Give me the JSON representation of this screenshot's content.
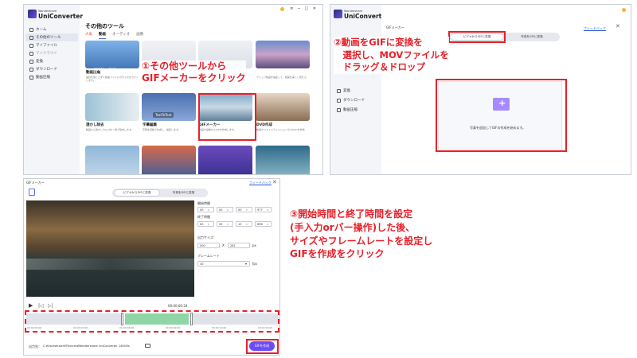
{
  "panel1": {
    "brand_small": "Wondershare",
    "brand_big": "UniConverter",
    "titlebar_icons": "≡ ─ □ ✕",
    "sidebar": [
      {
        "label": "ホーム",
        "active": false
      },
      {
        "label": "その他のツール",
        "active": true
      },
      {
        "label": "マイファイル",
        "active": false
      },
      {
        "label": "マイクラウド",
        "active": false
      },
      {
        "label": "変換",
        "active": false
      },
      {
        "label": "ダウンロード",
        "active": false
      },
      {
        "label": "動画圧縮",
        "active": false
      }
    ],
    "heading": "その他のツール",
    "tabs": [
      "人気",
      "動画",
      "オーディオ",
      "画像"
    ],
    "tiles": [
      {
        "title": "動画圧縮",
        "desc": "品質を落とさずに動画ファイルのサイズを小さくします。"
      },
      {
        "title": "",
        "desc": ""
      },
      {
        "title": "",
        "desc": ""
      },
      {
        "title": "",
        "desc": "クリップ動画を編集して、動画を美しく見せる"
      },
      {
        "title": "透かし除去",
        "desc": "動画から透かしやロゴを一括で除去します。"
      },
      {
        "title": "字幕編集",
        "desc": "字幕を自動で生成し、編集します。"
      },
      {
        "title": "GIFメーカー",
        "desc": "動画や画像からGIFを作成します。"
      },
      {
        "title": "DVD作成",
        "desc": "動画やフォトスライドショーからDVDを作成"
      }
    ],
    "tile_texts": {
      "resolution": "200M → 20M",
      "text_to_text": "TextToText"
    },
    "annotation": "①その他ツールから\nGIFメーカーをクリック"
  },
  "panel2": {
    "brand_small": "Wondershare",
    "brand_big": "UniConvert",
    "window_title": "GIFメーカー",
    "feedback": "フィードバック",
    "close": "✕",
    "toggle": [
      "ビデオからGIFに変換",
      "写真をGIFに変換"
    ],
    "annotation": "②動画をGIFに変換を\n　選択し、MOVファイルを\n　ドラッグ＆ドロップ",
    "sidebar": [
      "変換",
      "ダウンロード",
      "動画圧縮"
    ],
    "drop_text": "写真を追加してGIFの作成を始めます。",
    "add_symbol": "+"
  },
  "panel3": {
    "window_title": "GIFメーカー",
    "feedback": "フィードバック",
    "close": "✕",
    "toggle": [
      "ビデオからGIFに変換",
      "写真をGIFに変換"
    ],
    "start_label": "開始時間",
    "end_label": "終了時間",
    "start_time": [
      "00",
      "00",
      "00",
      "977"
    ],
    "end_time": [
      "00",
      "00",
      "15",
      "696"
    ],
    "size_label": "出力サイズ：",
    "width": "500",
    "height": "281",
    "unit": "px",
    "x_sign": "X",
    "fps_label": "フレームレート",
    "fps_value": "30",
    "fps_unit": "fps",
    "timecode": "00:00:00:24",
    "ruler": [
      "00:00:00:00",
      "00:00:03:00",
      "00:00:06:00",
      "00:00:09:00",
      "00:00:12:00",
      "00:00:15:00"
    ],
    "output_label": "出力先：",
    "output_path": "C:¥Users¥user¥Pictures¥Wondershare UniConverter 14¥Gifs",
    "create_button": "GIFを作成",
    "annotation": "③開始時間と終了時間を設定\n(手入力orバー操作)した後、\nサイズやフレームレートを設定し\nGIFを作成をクリック"
  },
  "colors": {
    "accent": "#e8202a",
    "brand": "#6b4cf5",
    "selection": "#8fd6a6"
  }
}
